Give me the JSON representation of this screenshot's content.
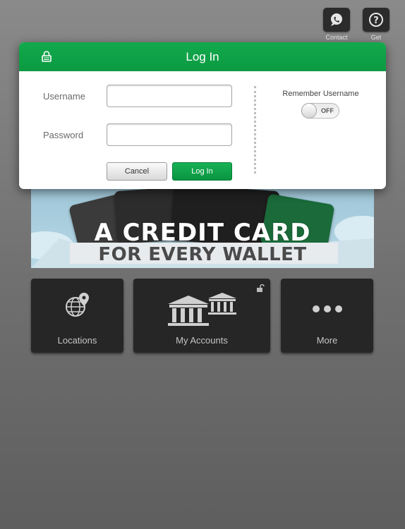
{
  "top_bar": {
    "contact_label": "Contact",
    "get_label": "Get"
  },
  "banner": {
    "line1": "A CREDIT CARD",
    "line2": "FOR EVERY WALLET"
  },
  "tiles": {
    "locations": "Locations",
    "my_accounts": "My Accounts",
    "more": "More"
  },
  "login": {
    "title": "Log In",
    "username_label": "Username",
    "password_label": "Password",
    "username_value": "",
    "password_value": "",
    "cancel_label": "Cancel",
    "login_label": "Log In",
    "remember_label": "Remember Username",
    "toggle_state": "OFF"
  },
  "colors": {
    "brand_green": "#0fa34a",
    "tile_bg": "#262626"
  }
}
